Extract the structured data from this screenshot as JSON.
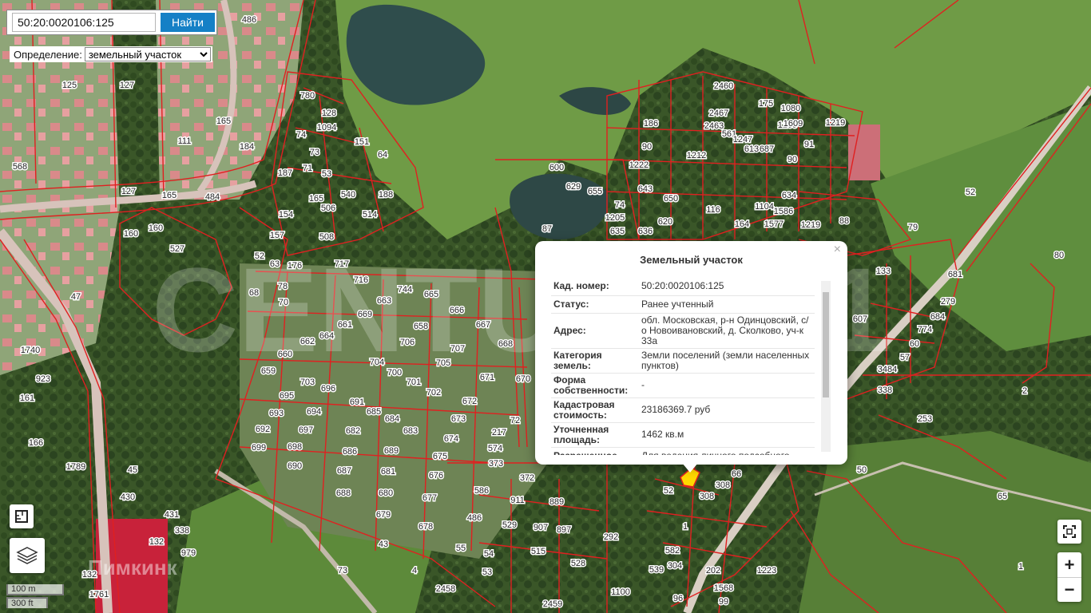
{
  "search": {
    "value": "50:20:0020106:125",
    "button_label": "Найти"
  },
  "definition": {
    "label": "Определение:",
    "selected": "земельный участок"
  },
  "watermark": "CENTURY 21",
  "attribution": "Пимкинк",
  "scale": {
    "metric": "100 m",
    "imperial": "300 ft"
  },
  "zoom": {
    "in_label": "+",
    "out_label": "−"
  },
  "icons": [
    "ruler-icon",
    "layers-icon",
    "fullscreen-icon",
    "close-icon"
  ],
  "colors": {
    "parcel_border": "#e02020",
    "button": "#1580c6",
    "highlight": "#ffd800"
  },
  "popup": {
    "title": "Земельный участок",
    "close": "×",
    "rows": [
      {
        "key": "Кад. номер:",
        "value": "50:20:0020106:125"
      },
      {
        "key": "Статус:",
        "value": "Ранее учтенный"
      },
      {
        "key": "Адрес:",
        "value": "обл. Московская, р-н Одинцовский, с/о Новоивановский, д. Сколково, уч-к 33а"
      },
      {
        "key": "Категория земель:",
        "value": "Земли поселений (земли населенных пунктов)"
      },
      {
        "key": "Форма собственности:",
        "value": "-"
      },
      {
        "key": "Кадастровая стоимость:",
        "value": "23186369.7 руб"
      },
      {
        "key": "Уточненная площадь:",
        "value": "1462 кв.м"
      },
      {
        "key": "Разрешенное",
        "value": "Для ведения личного подсобного"
      }
    ]
  },
  "map_labels": [
    "486",
    "127",
    "125",
    "165",
    "184",
    "568",
    "111",
    "484",
    "127",
    "165",
    "160",
    "160",
    "527",
    "47",
    "1740",
    "923",
    "161",
    "166",
    "1789",
    "45",
    "430",
    "431",
    "338",
    "132",
    "979",
    "132",
    "1761",
    "780",
    "128",
    "1094",
    "74",
    "73",
    "71",
    "53",
    "151",
    "64",
    "188",
    "540",
    "514",
    "187",
    "165",
    "506",
    "508",
    "154",
    "157",
    "52",
    "63",
    "176",
    "78",
    "68",
    "70",
    "717",
    "716",
    "744",
    "665",
    "666",
    "667",
    "668",
    "669",
    "663",
    "664",
    "661",
    "662",
    "660",
    "659",
    "658",
    "706",
    "707",
    "705",
    "704",
    "700",
    "701",
    "702",
    "703",
    "695",
    "696",
    "694",
    "693",
    "697",
    "692",
    "698",
    "699",
    "690",
    "691",
    "685",
    "684",
    "683",
    "682",
    "686",
    "687",
    "688",
    "689",
    "681",
    "680",
    "679",
    "678",
    "677",
    "676",
    "675",
    "674",
    "673",
    "672",
    "671",
    "670",
    "72",
    "217",
    "574",
    "373",
    "372",
    "911",
    "889",
    "907",
    "897",
    "515",
    "528",
    "529",
    "586",
    "486",
    "55",
    "54",
    "53",
    "43",
    "73",
    "4",
    "2458",
    "2459",
    "2460",
    "2467",
    "2463",
    "561",
    "1247",
    "175",
    "613",
    "687",
    "1080",
    "1235",
    "1609",
    "1219",
    "634",
    "90",
    "91",
    "186",
    "90",
    "1212",
    "1222",
    "600",
    "629",
    "643",
    "650",
    "655",
    "74",
    "1205",
    "635",
    "636",
    "620",
    "116",
    "164",
    "1104",
    "1577",
    "1586",
    "1219",
    "88",
    "87",
    "79",
    "133",
    "80",
    "681",
    "279",
    "684",
    "774",
    "607",
    "3484",
    "60",
    "57",
    "338",
    "253",
    "2",
    "50",
    "65",
    "1",
    "52",
    "52",
    "308",
    "308",
    "66",
    "1",
    "582",
    "292",
    "1223",
    "1100",
    "96",
    "99",
    "1568",
    "202",
    "304",
    "539",
    "479",
    "215",
    "216",
    "197",
    "2",
    "1"
  ]
}
